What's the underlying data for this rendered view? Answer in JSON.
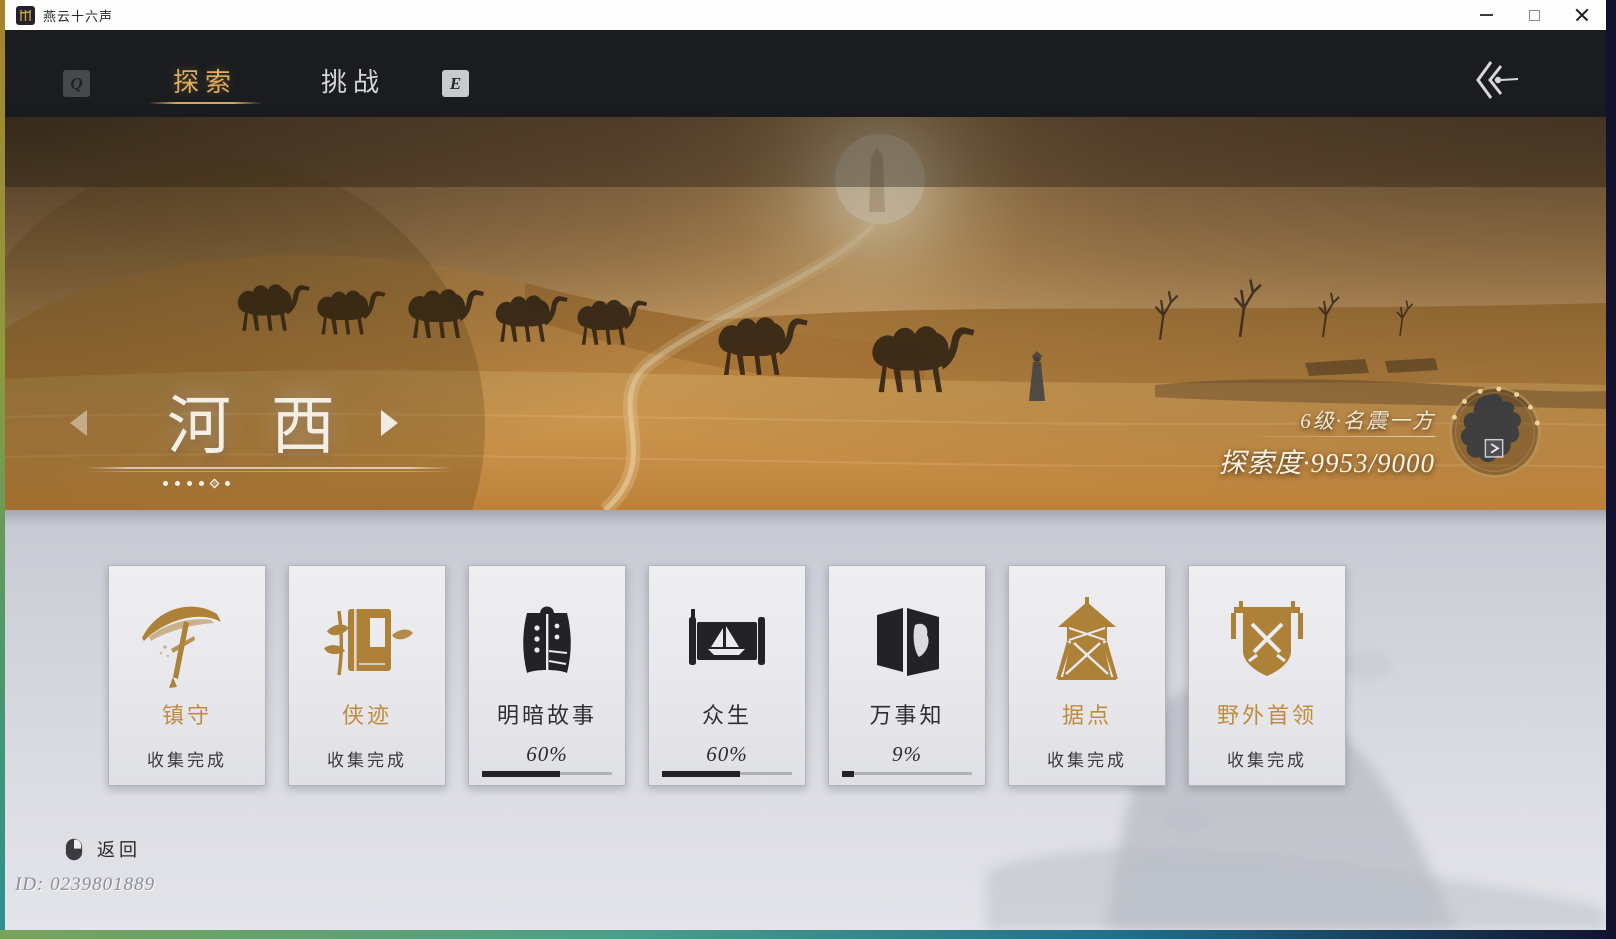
{
  "window": {
    "title": "燕云十六声"
  },
  "nav": {
    "key_prev": "Q",
    "key_next": "E",
    "tabs": [
      {
        "label": "探索",
        "active": true
      },
      {
        "label": "挑战",
        "active": false
      }
    ]
  },
  "hero": {
    "region_name": "河西",
    "level_badge": "6级·名震一方",
    "exploration": "探索度·9953/9000"
  },
  "cards": [
    {
      "title": "镇守",
      "status": "收集完成",
      "style": "gold",
      "icon": "parasol"
    },
    {
      "title": "侠迹",
      "status": "收集完成",
      "style": "gold",
      "icon": "book-bamboo"
    },
    {
      "title": "明暗故事",
      "status": "60%",
      "progress": 60,
      "style": "ink",
      "icon": "bell"
    },
    {
      "title": "众生",
      "status": "60%",
      "progress": 60,
      "style": "ink",
      "icon": "scroll-boat"
    },
    {
      "title": "万事知",
      "status": "9%",
      "progress": 9,
      "style": "ink",
      "icon": "folding-screen"
    },
    {
      "title": "据点",
      "status": "收集完成",
      "style": "gold",
      "icon": "watchtower"
    },
    {
      "title": "野外首领",
      "status": "收集完成",
      "style": "gold",
      "icon": "banner"
    }
  ],
  "footer": {
    "back_label": "返回",
    "player_id": "ID: 0239801889"
  },
  "colors": {
    "accent_gold": "#c08a3d",
    "ink": "#232327",
    "nav_bg": "#1a1c20"
  }
}
